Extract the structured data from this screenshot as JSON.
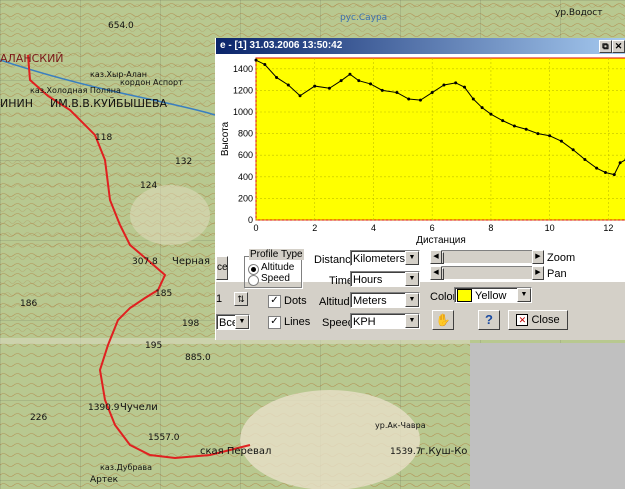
{
  "window": {
    "title": "e - [1] 31.03.2006 13:50:42",
    "btn_restore": "⧉",
    "btn_close": "✕"
  },
  "chart_data": {
    "type": "line",
    "ylabel": "Высота",
    "xlabel": "Дистанция",
    "xlim": [
      0,
      12.6
    ],
    "ylim": [
      0,
      1500
    ],
    "xticks": [
      0,
      2,
      4,
      6,
      8,
      10,
      12
    ],
    "yticks": [
      0,
      200,
      400,
      600,
      800,
      1000,
      1200,
      1400
    ],
    "grid": true,
    "background": "#ffff00",
    "line_color": "#000000",
    "x": [
      0,
      0.3,
      0.7,
      1.1,
      1.5,
      2.0,
      2.5,
      2.9,
      3.2,
      3.5,
      3.9,
      4.3,
      4.8,
      5.2,
      5.6,
      6.0,
      6.4,
      6.8,
      7.1,
      7.4,
      7.7,
      8.0,
      8.4,
      8.8,
      9.2,
      9.6,
      10.0,
      10.4,
      10.8,
      11.2,
      11.6,
      11.9,
      12.2,
      12.4,
      12.6
    ],
    "y": [
      1480,
      1440,
      1320,
      1250,
      1150,
      1240,
      1220,
      1290,
      1350,
      1290,
      1260,
      1200,
      1180,
      1120,
      1110,
      1180,
      1250,
      1270,
      1230,
      1120,
      1040,
      980,
      920,
      870,
      840,
      800,
      780,
      730,
      650,
      560,
      480,
      440,
      420,
      530,
      560
    ]
  },
  "controls": {
    "partial_button": "ce",
    "partial_value": "1",
    "partial_select": "Все",
    "profile_type": {
      "legend": "Profile Type",
      "options": [
        "Altitude",
        "Speed"
      ],
      "selected": "Altitude"
    },
    "dots_label": "Dots",
    "lines_label": "Lines",
    "dots_checked": true,
    "lines_checked": true,
    "distance_label": "Distance",
    "distance_value": "Kilometers",
    "time_label": "Time",
    "time_value": "Hours",
    "altitude_label": "Altitude",
    "altitude_value": "Meters",
    "speed_label": "Speed",
    "speed_value": "KPH",
    "zoom_label": "Zoom",
    "pan_label": "Pan",
    "color_label": "Color",
    "color_value": "Yellow",
    "color_hex": "#ffff00",
    "help_label": "?",
    "close_label": "Close"
  },
  "map": {
    "labels": [
      "АЛАНСКИЙ",
      "каз.Хыр-Алан",
      "кордон Аспорт",
      "каз.Холодная Поляна",
      "ИНИН",
      "ИМ.В.В.КУЙБЫШЕВА",
      "118",
      "124",
      "132",
      "307.8",
      "Черная",
      "185",
      "186",
      "198",
      "1390.9",
      "Чучели",
      "1557.0",
      "1539.7",
      "г.Куш-Ко",
      "Артек",
      "каз.Дубрава",
      "ская Перевал",
      "ур.Ак-Чавра",
      "654.0",
      "885.0",
      "226",
      "195",
      "рус.Саура",
      "ур.Водост"
    ]
  }
}
